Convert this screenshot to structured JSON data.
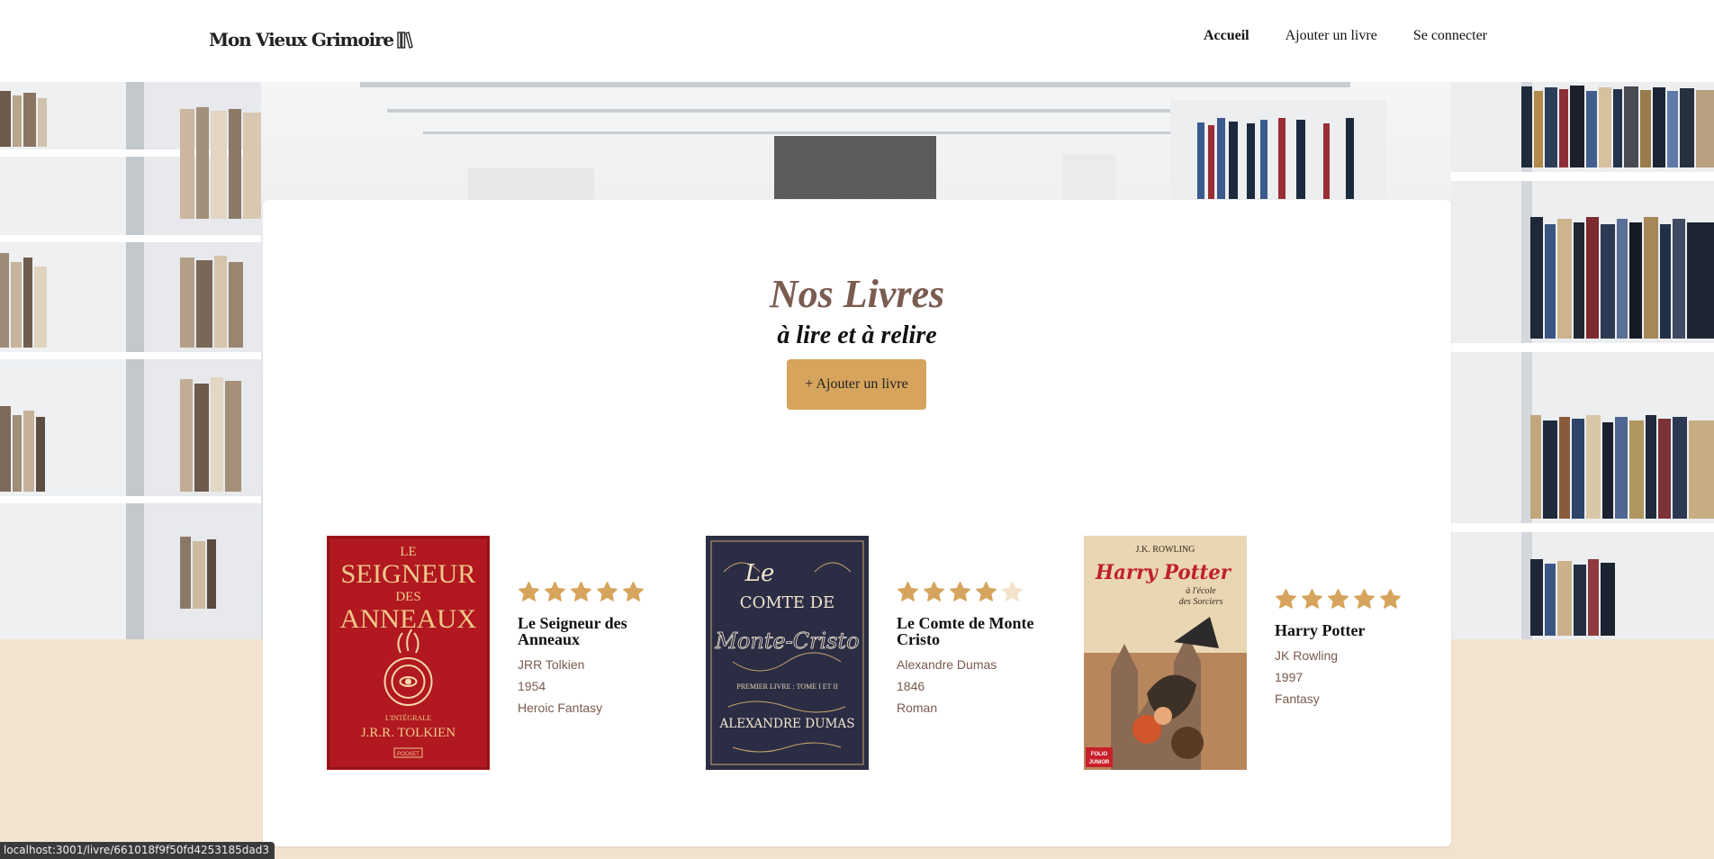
{
  "header": {
    "logo_text": "Mon Vieux Grimoire",
    "nav": [
      {
        "label": "Accueil",
        "active": true
      },
      {
        "label": "Ajouter un livre",
        "active": false
      },
      {
        "label": "Se connecter",
        "active": false
      }
    ]
  },
  "main": {
    "title": "Nos Livres",
    "subtitle": "à lire et à relire",
    "add_button": "+ Ajouter un livre"
  },
  "books": [
    {
      "title": "Le Seigneur des Anneaux",
      "author": "JRR Tolkien",
      "year": "1954",
      "genre": "Heroic Fantasy",
      "rating": 5,
      "cover": {
        "line1": "LE",
        "line2": "SEIGNEUR",
        "line3": "DES",
        "line4": "ANNEAUX",
        "small": "L'INTÉGRALE",
        "author": "J.R.R. TOLKIEN",
        "badge": "POCKET"
      }
    },
    {
      "title": "Le Comte de Monte Cristo",
      "author": "Alexandre Dumas",
      "year": "1846",
      "genre": "Roman",
      "rating": 4,
      "cover": {
        "line1": "Le",
        "line2": "COMTE DE",
        "line3": "Monte-Cristo",
        "small": "PREMIER LIVRE : TOME I ET II",
        "author": "ALEXANDRE DUMAS"
      }
    },
    {
      "title": "Harry Potter",
      "author": "JK Rowling",
      "year": "1997",
      "genre": "Fantasy",
      "rating": 5,
      "cover": {
        "author": "J.K. ROWLING",
        "line1": "Harry Potter",
        "line2": "à l'école",
        "line3": "des Sorciers",
        "badge1": "FOLIO",
        "badge2": "JUNIOR"
      }
    }
  ],
  "status_bar": "localhost:3001/livre/661018f9f50fd4253185dad3",
  "colors": {
    "accent": "#d6a45c",
    "title": "#7a5c50",
    "meta": "#7b5a4e",
    "page_bg": "#f2e3cf",
    "star_empty": "#f3e3cb"
  }
}
